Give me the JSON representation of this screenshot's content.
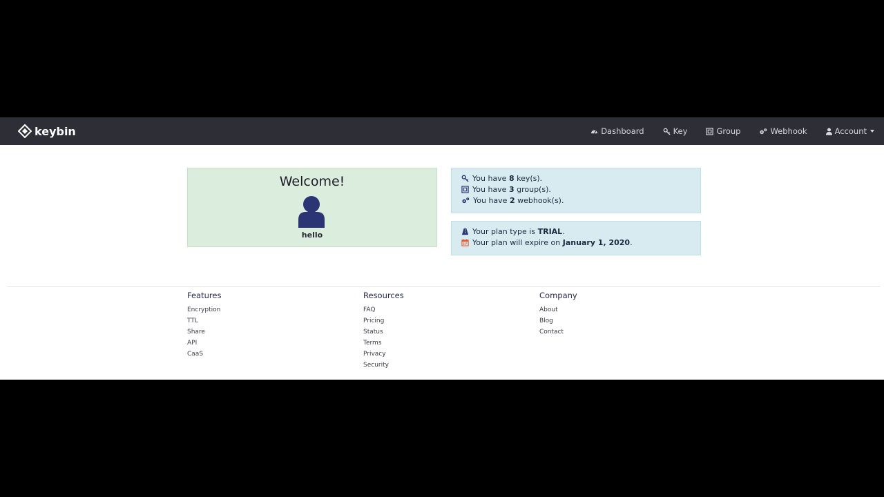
{
  "brand": {
    "name": "keybin"
  },
  "nav": {
    "items": [
      {
        "label": "Dashboard",
        "icon": "dashboard-icon"
      },
      {
        "label": "Key",
        "icon": "key-icon"
      },
      {
        "label": "Group",
        "icon": "group-icon"
      },
      {
        "label": "Webhook",
        "icon": "cogs-icon"
      },
      {
        "label": "Account",
        "icon": "user-icon"
      }
    ]
  },
  "welcome": {
    "title": "Welcome!",
    "username": "hello"
  },
  "counts": {
    "prefix": "You have",
    "keys": {
      "count": "8",
      "suffix": "key(s)."
    },
    "groups": {
      "count": "3",
      "suffix": "group(s)."
    },
    "webhooks": {
      "count": "2",
      "suffix": "webhook(s)."
    }
  },
  "plan": {
    "type_label": "Your plan type is",
    "type_value": "TRIAL",
    "expire_label": "Your plan will expire on",
    "expire_value": "January 1, 2020"
  },
  "footer": {
    "features": {
      "title": "Features",
      "links": [
        "Encryption",
        "TTL",
        "Share",
        "API",
        "CaaS"
      ]
    },
    "resources": {
      "title": "Resources",
      "links": [
        "FAQ",
        "Pricing",
        "Status",
        "Terms",
        "Privacy",
        "Security"
      ]
    },
    "company": {
      "title": "Company",
      "links": [
        "About",
        "Blog",
        "Contact"
      ]
    }
  },
  "colors": {
    "navbar": "#2d2e36",
    "welcome_bg": "#dbeddc",
    "info_bg": "#d7ebf0",
    "avatar": "#2c3573",
    "calendar": "#e8572a"
  }
}
